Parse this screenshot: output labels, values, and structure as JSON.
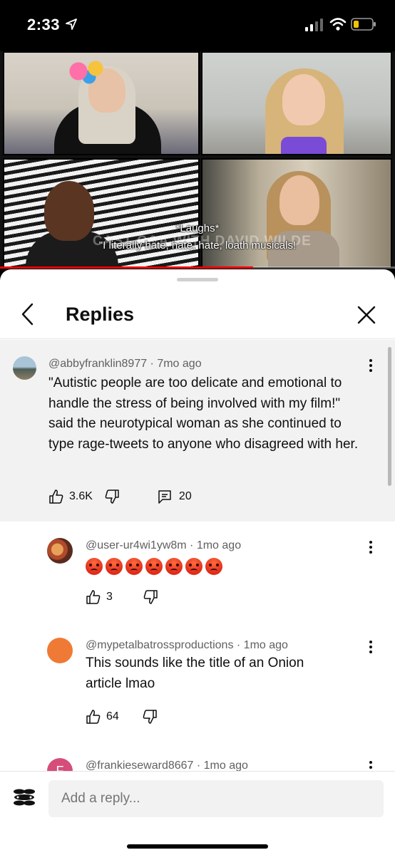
{
  "status_bar": {
    "time": "2:33",
    "icons": [
      "location-arrow-icon",
      "signal-icon",
      "wifi-icon",
      "battery-icon"
    ]
  },
  "video": {
    "captions": [
      "*Laughs*",
      "\"I literally hate, hate, hate, loath musicals!"
    ],
    "watermark": "CAST Q&A WITH DAVID WILDE",
    "progress_percent": 64,
    "accent_color": "#ee0000"
  },
  "panel": {
    "title": "Replies",
    "back_icon": "chevron-left-icon",
    "close_icon": "close-icon"
  },
  "parent_comment": {
    "author": "@abbyfranklin8977",
    "time": "7mo ago",
    "text": "\"Autistic people are too delicate and emotional to handle the stress of being involved with my film!\" said the neurotypical woman as she continued to type rage-tweets to anyone who disagreed with her.",
    "likes": "3.6K",
    "replies": "20"
  },
  "replies": [
    {
      "author": "@user-ur4wi1yw8m",
      "time": "1mo ago",
      "emoji_count": 7,
      "emoji": "angry-face",
      "likes": "3"
    },
    {
      "author": "@mypetalbatrossproductions",
      "time": "1mo ago",
      "text": "This sounds like the title of an Onion article lmao",
      "likes": "64"
    },
    {
      "author": "@frankieseward8667",
      "time": "1mo ago",
      "avatar_letter": "F"
    }
  ],
  "reply_bar": {
    "placeholder": "Add a reply..."
  }
}
